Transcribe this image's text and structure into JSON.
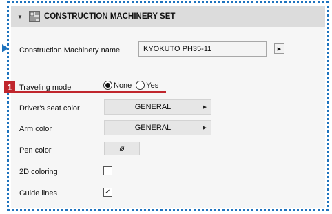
{
  "header": {
    "title": "CONSTRUCTION MACHINERY SET",
    "collapse_icon": "chevron-down-icon",
    "machine_icon": "machinery-set-icon"
  },
  "machinery_name": {
    "label": "Construction Machinery name",
    "value": "KYOKUTO PH35-11",
    "arrow_icon": "arrow-right-icon"
  },
  "traveling_mode": {
    "marker": "1",
    "label": "Traveling mode",
    "options": [
      "None",
      "Yes"
    ],
    "selected": "None"
  },
  "drivers_seat_color": {
    "label": "Driver's seat color",
    "value": "GENERAL"
  },
  "arm_color": {
    "label": "Arm color",
    "value": "GENERAL"
  },
  "pen_color": {
    "label": "Pen color",
    "value": "ø"
  },
  "coloring_2d": {
    "label": "2D coloring",
    "checked": false
  },
  "guide_lines": {
    "label": "Guide lines",
    "checked": true,
    "check_glyph": "✓"
  },
  "colors": {
    "accent_dotted_frame": "#1e73be",
    "marker_red": "#c0262d"
  }
}
